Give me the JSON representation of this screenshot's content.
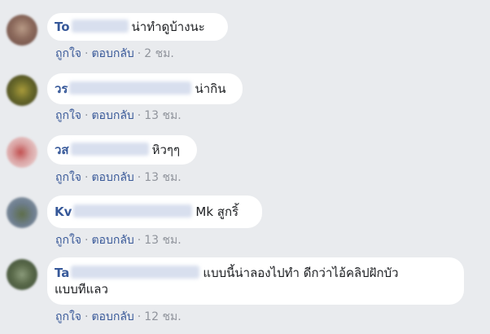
{
  "comments": [
    {
      "name": "To",
      "text": "น่าทำดูบ้างนะ",
      "like": "ถูกใจ",
      "reply": "ตอบกลับ",
      "time": "2 ชม."
    },
    {
      "name": "วร",
      "text": "น่ากิน",
      "like": "ถูกใจ",
      "reply": "ตอบกลับ",
      "time": "13 ชม."
    },
    {
      "name": "วส",
      "text": "หิวๆๆ",
      "like": "ถูกใจ",
      "reply": "ตอบกลับ",
      "time": "13 ชม."
    },
    {
      "name": "Kv",
      "text": "Mk สูกริ้",
      "like": "ถูกใจ",
      "reply": "ตอบกลับ",
      "time": "13 ชม."
    },
    {
      "name": "Ta",
      "text_line1": "แบบนี้น่าลองไปทำ ดีกว่าไอ้คลิปฝักบัว",
      "text_line2": "แบบทีแลว",
      "like": "ถูกใจ",
      "reply": "ตอบกลับ",
      "time": "12 ชม."
    }
  ],
  "colors": {
    "background": "#e9ebee",
    "bubble": "#ffffff",
    "name": "#365899",
    "link": "#385898",
    "meta": "#90949c"
  }
}
